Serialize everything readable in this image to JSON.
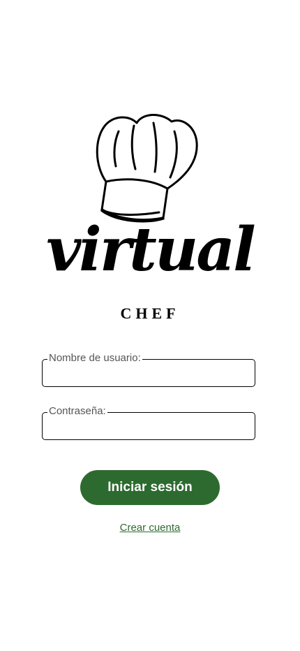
{
  "logo": {
    "script_text": "virtual",
    "sub_text": "CHEF",
    "icon": "chef-hat-icon"
  },
  "form": {
    "username_label": "Nombre de usuario:",
    "username_value": "",
    "password_label": "Contraseña:",
    "password_value": "",
    "login_label": "Iniciar sesión",
    "create_account_label": "Crear cuenta"
  },
  "colors": {
    "primary": "#2d6a2f",
    "background": "#ffffff",
    "text": "#000000"
  }
}
